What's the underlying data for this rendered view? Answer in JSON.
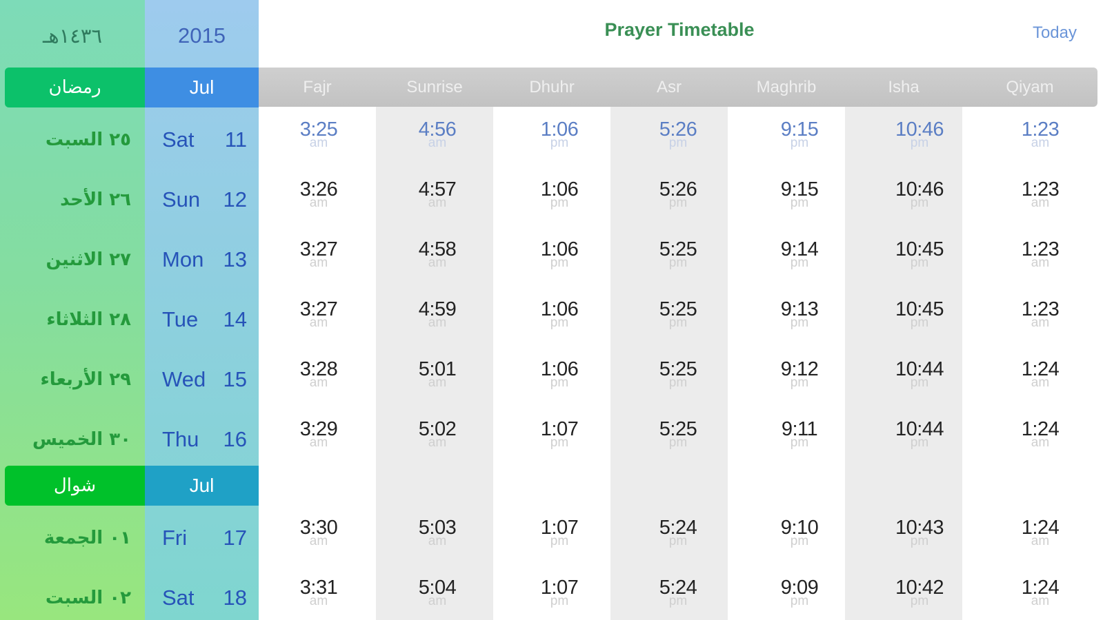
{
  "header": {
    "hijri_year": "١٤٣٦هـ",
    "gregorian_year": "2015",
    "title": "Prayer Timetable",
    "today_label": "Today"
  },
  "columns": [
    "Fajr",
    "Sunrise",
    "Dhuhr",
    "Asr",
    "Maghrib",
    "Isha",
    "Qiyam"
  ],
  "colors": {
    "hijri_month_bar_1": "#0cc16a",
    "hijri_month_bar_2": "#00c12a",
    "greg_month_bar_1": "#3e8ee3",
    "greg_month_bar_2": "#1fa1c6",
    "title": "#3a8f55",
    "today": "#6b95d8"
  },
  "groups": [
    {
      "hijri_month": "رمضان",
      "greg_month": "Jul",
      "days": [
        {
          "hijri": "٢٥ السبت",
          "weekday": "Sat",
          "day": "11",
          "times": [
            [
              "3:25",
              "am"
            ],
            [
              "4:56",
              "am"
            ],
            [
              "1:06",
              "pm"
            ],
            [
              "5:26",
              "pm"
            ],
            [
              "9:15",
              "pm"
            ],
            [
              "10:46",
              "pm"
            ],
            [
              "1:23",
              "am"
            ]
          ]
        },
        {
          "hijri": "٢٦ الأحد",
          "weekday": "Sun",
          "day": "12",
          "times": [
            [
              "3:26",
              "am"
            ],
            [
              "4:57",
              "am"
            ],
            [
              "1:06",
              "pm"
            ],
            [
              "5:26",
              "pm"
            ],
            [
              "9:15",
              "pm"
            ],
            [
              "10:46",
              "pm"
            ],
            [
              "1:23",
              "am"
            ]
          ]
        },
        {
          "hijri": "٢٧ الاثنين",
          "weekday": "Mon",
          "day": "13",
          "times": [
            [
              "3:27",
              "am"
            ],
            [
              "4:58",
              "am"
            ],
            [
              "1:06",
              "pm"
            ],
            [
              "5:25",
              "pm"
            ],
            [
              "9:14",
              "pm"
            ],
            [
              "10:45",
              "pm"
            ],
            [
              "1:23",
              "am"
            ]
          ]
        },
        {
          "hijri": "٢٨ الثلاثاء",
          "weekday": "Tue",
          "day": "14",
          "times": [
            [
              "3:27",
              "am"
            ],
            [
              "4:59",
              "am"
            ],
            [
              "1:06",
              "pm"
            ],
            [
              "5:25",
              "pm"
            ],
            [
              "9:13",
              "pm"
            ],
            [
              "10:45",
              "pm"
            ],
            [
              "1:23",
              "am"
            ]
          ]
        },
        {
          "hijri": "٢٩ الأربعاء",
          "weekday": "Wed",
          "day": "15",
          "times": [
            [
              "3:28",
              "am"
            ],
            [
              "5:01",
              "am"
            ],
            [
              "1:06",
              "pm"
            ],
            [
              "5:25",
              "pm"
            ],
            [
              "9:12",
              "pm"
            ],
            [
              "10:44",
              "pm"
            ],
            [
              "1:24",
              "am"
            ]
          ]
        },
        {
          "hijri": "٣٠ الخميس",
          "weekday": "Thu",
          "day": "16",
          "times": [
            [
              "3:29",
              "am"
            ],
            [
              "5:02",
              "am"
            ],
            [
              "1:07",
              "pm"
            ],
            [
              "5:25",
              "pm"
            ],
            [
              "9:11",
              "pm"
            ],
            [
              "10:44",
              "pm"
            ],
            [
              "1:24",
              "am"
            ]
          ]
        }
      ]
    },
    {
      "hijri_month": "شوال",
      "greg_month": "Jul",
      "days": [
        {
          "hijri": "٠١ الجمعة",
          "weekday": "Fri",
          "day": "17",
          "times": [
            [
              "3:30",
              "am"
            ],
            [
              "5:03",
              "am"
            ],
            [
              "1:07",
              "pm"
            ],
            [
              "5:24",
              "pm"
            ],
            [
              "9:10",
              "pm"
            ],
            [
              "10:43",
              "pm"
            ],
            [
              "1:24",
              "am"
            ]
          ]
        },
        {
          "hijri": "٠٢ السبت",
          "weekday": "Sat",
          "day": "18",
          "times": [
            [
              "3:31",
              "am"
            ],
            [
              "5:04",
              "am"
            ],
            [
              "1:07",
              "pm"
            ],
            [
              "5:24",
              "pm"
            ],
            [
              "9:09",
              "pm"
            ],
            [
              "10:42",
              "pm"
            ],
            [
              "1:24",
              "am"
            ]
          ]
        }
      ]
    }
  ]
}
